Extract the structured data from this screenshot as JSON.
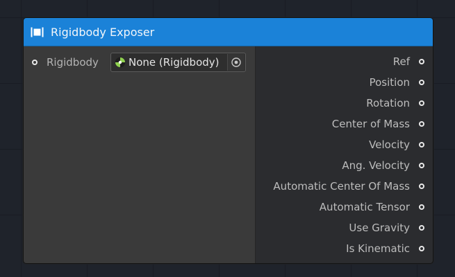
{
  "node": {
    "title": "Rigidbody Exposer",
    "icon": "rigidbody-node-icon",
    "header_color": "#1b82d8"
  },
  "inputs": [
    {
      "label": "Rigidbody",
      "field_value": "None (Rigidbody)",
      "field_icon": "rigidbody-object-icon",
      "picker_icon": "object-picker-icon"
    }
  ],
  "outputs": [
    {
      "label": "Ref"
    },
    {
      "label": "Position"
    },
    {
      "label": "Rotation"
    },
    {
      "label": "Center of Mass"
    },
    {
      "label": "Velocity"
    },
    {
      "label": "Ang. Velocity"
    },
    {
      "label": "Automatic Center Of Mass"
    },
    {
      "label": "Automatic Tensor"
    },
    {
      "label": "Use Gravity"
    },
    {
      "label": "Is Kinematic"
    }
  ]
}
